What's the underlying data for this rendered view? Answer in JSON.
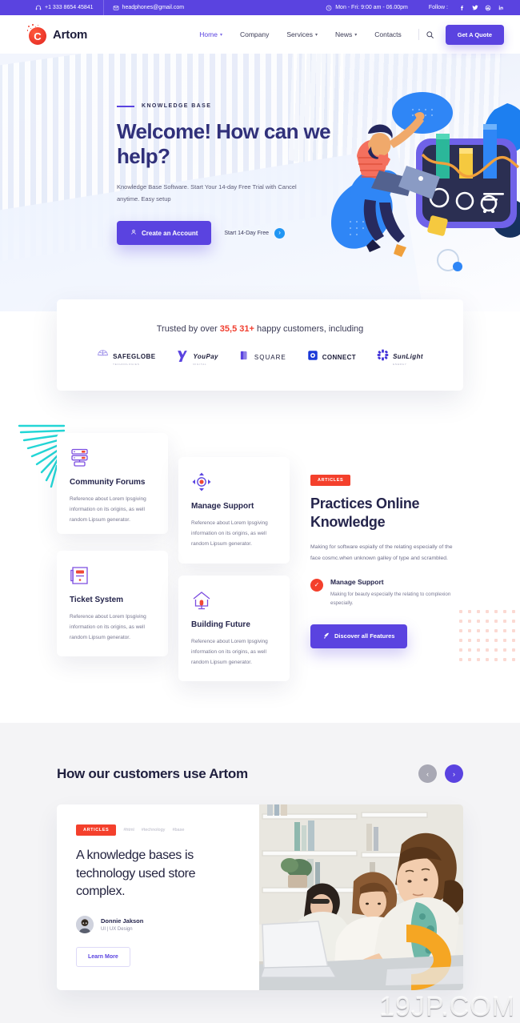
{
  "topbar": {
    "phone": "+1 333 8654 45841",
    "email": "headphones@gmail.com",
    "hours": "Mon - Fri: 9:00 am - 06.00pm",
    "follow_label": "Follow :",
    "socials": [
      "facebook-icon",
      "twitter-icon",
      "dribbble-icon",
      "linkedin-icon"
    ],
    "bg": "#5a43e0"
  },
  "header": {
    "brand": "Artom",
    "logo_letter": "C",
    "nav": [
      {
        "label": "Home",
        "has_caret": true,
        "active": true
      },
      {
        "label": "Company",
        "has_caret": false,
        "active": false
      },
      {
        "label": "Services",
        "has_caret": true,
        "active": false
      },
      {
        "label": "News",
        "has_caret": true,
        "active": false
      },
      {
        "label": "Contacts",
        "has_caret": false,
        "active": false
      }
    ],
    "search_icon": "search-icon",
    "quote_button": "Get A Quote"
  },
  "hero": {
    "eyebrow": "KNOWLEDGE BASE",
    "title": "Welcome! How can we help?",
    "subtitle": "Knowledge Base Software. Start Your 14-day Free Trial with Cancel anytime. Easy setup",
    "primary_cta": "Create an Account",
    "secondary_cta": "Start 14-Day Free"
  },
  "trusted": {
    "prefix": "Trusted by over ",
    "count": "35,5 31+",
    "suffix": " happy customers, including",
    "logos": [
      {
        "name": "SAFEGLOBE",
        "sub": "TECHNOLOGIES"
      },
      {
        "name": "YouPay",
        "sub": "DIGITAL"
      },
      {
        "name": "SQUARE",
        "sub": ""
      },
      {
        "name": "CONNECT",
        "sub": ""
      },
      {
        "name": "SunLight",
        "sub": "ENERGY"
      }
    ]
  },
  "features": {
    "cards": [
      {
        "title": "Community Forums",
        "icon": "server-stack-icon",
        "text": "Reference about Lorem Ipsgiving information on its origins, as well random Lipsum generator."
      },
      {
        "title": "Manage Support",
        "icon": "move-target-icon",
        "text": "Reference about Lorem Ipsgiving information on its origins, as well random Lipsum generator."
      },
      {
        "title": "Ticket System",
        "icon": "ticket-icon",
        "text": "Reference about Lorem Ipsgiving information on its origins, as well random Lipsum generator."
      },
      {
        "title": "Building Future",
        "icon": "house-icon",
        "text": "Reference about Lorem Ipsgiving information on its origins, as well random Lipsum generator."
      }
    ],
    "panel": {
      "tag": "ARTICLES",
      "title": "Practices Online Knowledge",
      "lead": "Making for software espially of the relating especially of the face cosmc.when unknown galley of type and scrambled.",
      "item_title": "Manage Support",
      "item_text": "Making for beauty especially the relating to complexion especially.",
      "cta": "Discover all Features"
    }
  },
  "customers": {
    "heading": "How our customers use Artom",
    "prev_icon": "chevron-left-icon",
    "next_icon": "chevron-right-icon",
    "testimonial": {
      "badge": "ARTICLES",
      "tags": [
        "#html",
        "#technology",
        "#base"
      ],
      "quote": "A knowledge bases is technology used store complex.",
      "author_name": "Donnie Jakson",
      "author_role": "UI | UX Design",
      "cta": "Learn More"
    }
  },
  "watermark": "19JP.COM",
  "colors": {
    "primary": "#5a43e0",
    "accent_red": "#f4402c",
    "blue": "#2196f3",
    "dark": "#25254c",
    "section_bg": "#f4f4f6"
  }
}
